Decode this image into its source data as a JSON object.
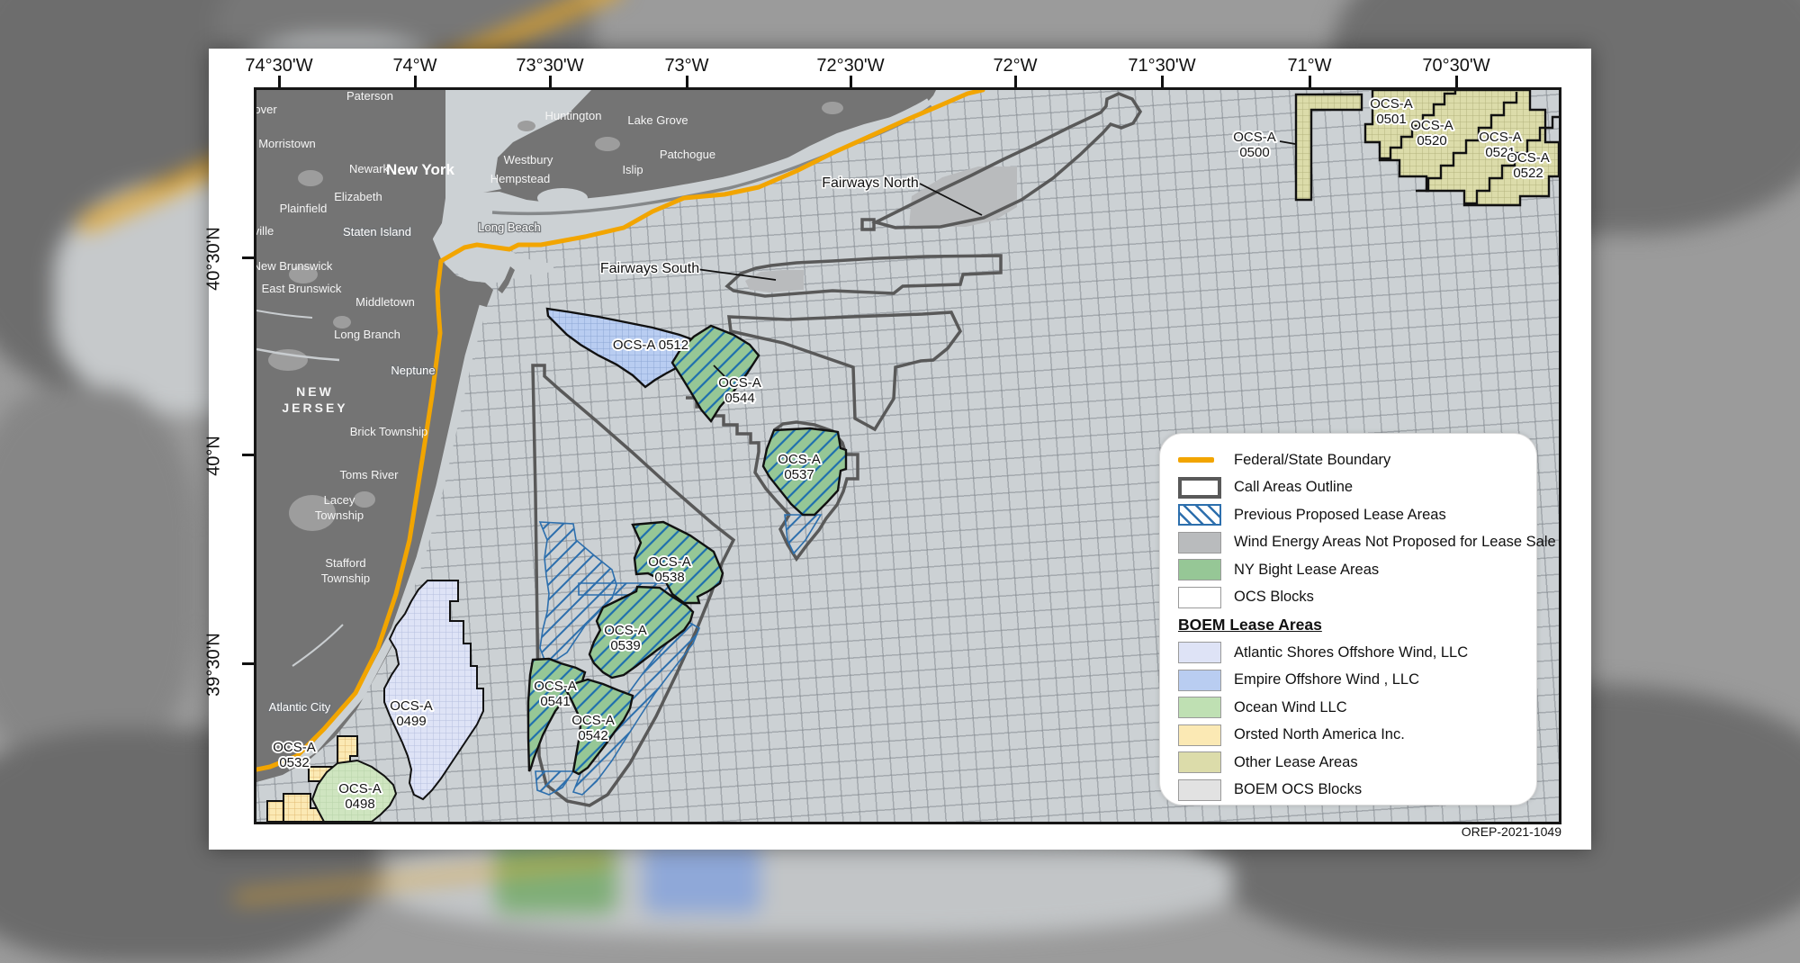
{
  "footer": {
    "map_id": "OREP-2021-1049"
  },
  "axes": {
    "top": [
      "74°30'W",
      "74°W",
      "73°30'W",
      "73°W",
      "72°30'W",
      "72°W",
      "71°30'W",
      "71°W",
      "70°30'W"
    ],
    "left": [
      "40°30'N",
      "40°N",
      "39°30'N"
    ]
  },
  "legend": {
    "items": [
      {
        "label": "Federal/State Boundary",
        "type": "line",
        "color": "#F2A500"
      },
      {
        "label": "Call Areas Outline",
        "type": "outline",
        "color": "#595959"
      },
      {
        "label": "Previous Proposed Lease Areas",
        "type": "hatch",
        "color": "#2D6FAD"
      },
      {
        "label": "Wind Energy Areas Not Proposed for Lease Sale",
        "type": "fill",
        "color": "#B9BBBD"
      },
      {
        "label": "NY Bight Lease Areas",
        "type": "fill",
        "color": "#96C796"
      },
      {
        "label": "OCS Blocks",
        "type": "fill",
        "color": "#FFFFFF"
      }
    ],
    "boem_header": "BOEM Lease Areas",
    "boem_items": [
      {
        "label": "Atlantic Shores Offshore Wind, LLC",
        "color": "#DEE3F6"
      },
      {
        "label": "Empire Offshore Wind , LLC",
        "color": "#B9CDF1"
      },
      {
        "label": "Ocean Wind LLC",
        "color": "#BFE0B3"
      },
      {
        "label": "Orsted North America Inc.",
        "color": "#FBE9B4"
      },
      {
        "label": "Other Lease Areas",
        "color": "#DCDCAA"
      },
      {
        "label": "BOEM OCS Blocks",
        "color": "#E2E2E2"
      }
    ]
  },
  "map": {
    "call_labels": {
      "north": "Fairways North",
      "south": "Fairways South"
    },
    "lease_labels": [
      {
        "l1": "OCS-A 0512"
      },
      {
        "l1": "OCS-A",
        "l2": "0544"
      },
      {
        "l1": "OCS-A",
        "l2": "0537"
      },
      {
        "l1": "OCS-A",
        "l2": "0538"
      },
      {
        "l1": "OCS-A",
        "l2": "0539"
      },
      {
        "l1": "OCS-A",
        "l2": "0541"
      },
      {
        "l1": "OCS-A",
        "l2": "0542"
      },
      {
        "l1": "OCS-A",
        "l2": "0499"
      },
      {
        "l1": "OCS-A",
        "l2": "0532"
      },
      {
        "l1": "OCS-A",
        "l2": "0498"
      },
      {
        "l1": "OCS-A",
        "l2": "0500"
      },
      {
        "l1": "OCS-A",
        "l2": "0501"
      },
      {
        "l1": "OCS-A",
        "l2": "0520"
      },
      {
        "l1": "OCS-A",
        "l2": "0521"
      },
      {
        "l1": "OCS-A",
        "l2": "0522"
      }
    ],
    "place_labels": [
      "Paterson",
      "over",
      "Huntington",
      "Lake Grove",
      "Morristown",
      "Patchogue",
      "Westbury",
      "Islip",
      "Newark",
      "New York",
      "Hempstead",
      "Elizabeth",
      "Plainfield",
      "Staten Island",
      "Long Beach",
      "ville",
      "New Brunswick",
      "East Brunswick",
      "Middletown",
      "Long Branch",
      "Neptune",
      "NEW",
      "JERSEY",
      "Brick Township",
      "Toms River",
      "Lacey",
      "Township",
      "Stafford",
      "Township",
      "Atlantic City"
    ],
    "colors": {
      "ocean": "#CCD1D4",
      "land": "#747474",
      "boundary_orange": "#F2A500",
      "call_outline": "#595959",
      "ny_bight_green": "#96C796",
      "hatch_blue": "#2D6FAD",
      "empire_blue": "#B9CDF1",
      "atlantic_shores": "#DEE3F6",
      "ocean_wind": "#CFE5C0",
      "orsted_yellow": "#FBE9B4",
      "other_olive": "#DCDCAA",
      "wea_gray": "#B9BBBD"
    }
  }
}
